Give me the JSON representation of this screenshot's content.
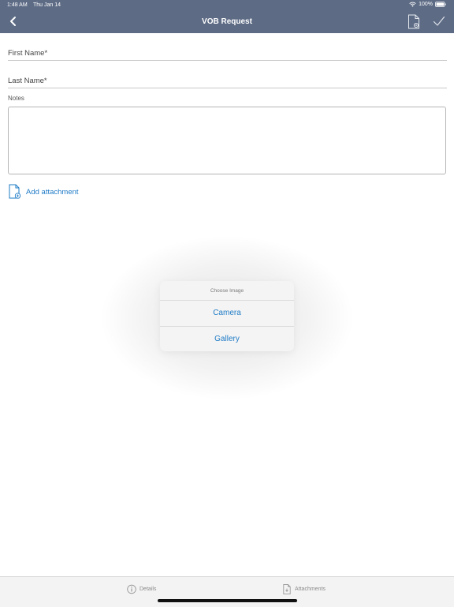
{
  "status_bar": {
    "time": "1:48 AM",
    "date": "Thu Jan 14",
    "battery": "100%"
  },
  "nav": {
    "title": "VOB Request"
  },
  "form": {
    "first_name_label": "First Name*",
    "last_name_label": "Last Name*",
    "notes_label": "Notes",
    "add_attachment_label": "Add attachment"
  },
  "dialog": {
    "title": "Choose Image",
    "options": [
      "Camera",
      "Gallery"
    ]
  },
  "tabs": [
    {
      "label": "Details",
      "icon": "info-circle-icon"
    },
    {
      "label": "Attachments",
      "icon": "attachment-doc-icon"
    }
  ],
  "colors": {
    "header": "#5d6b85",
    "accent": "#1e7bc6"
  }
}
